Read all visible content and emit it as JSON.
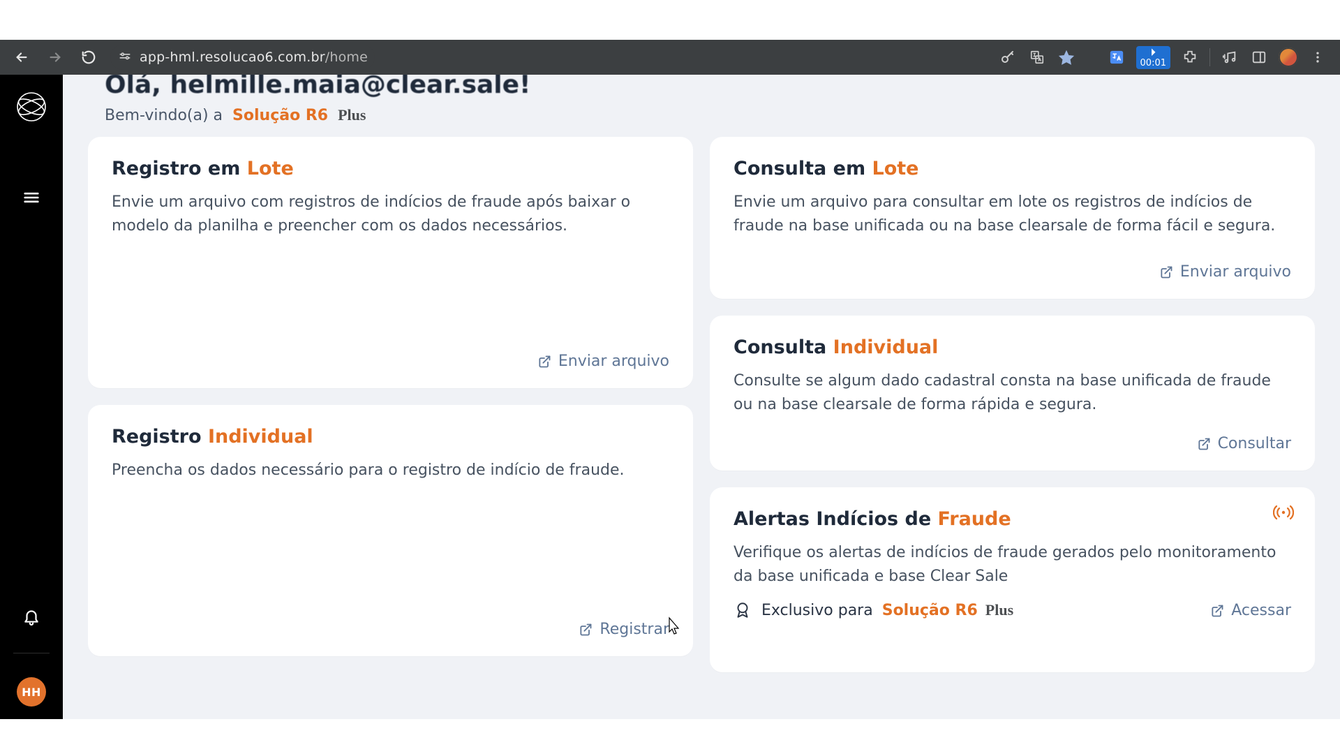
{
  "browser": {
    "url_host": "app-hml.resolucao6.com.br",
    "url_path": "/home",
    "timer": "00:01"
  },
  "sidebar": {
    "user_initials": "HH"
  },
  "header": {
    "greeting": "Olá, helmille.maia@clear.sale!",
    "welcome": "Bem-vindo(a) a",
    "brand": "Solução R6",
    "plus": "Plus"
  },
  "cards": {
    "registro_lote": {
      "title_a": "Registro em ",
      "title_b": "Lote",
      "body": "Envie um arquivo com registros de indícios de fraude após baixar o modelo da planilha e preencher com os dados necessários.",
      "action": "Enviar arquivo"
    },
    "registro_individual": {
      "title_a": "Registro ",
      "title_b": "Individual",
      "body": "Preencha os dados necessário para o registro de indício de fraude.",
      "action": "Registrar"
    },
    "consulta_lote": {
      "title_a": "Consulta em ",
      "title_b": "Lote",
      "body": "Envie um arquivo para consultar em lote os registros de indícios de fraude na base unificada ou na base clearsale de forma fácil e segura.",
      "action": "Enviar arquivo"
    },
    "consulta_individual": {
      "title_a": "Consulta ",
      "title_b": "Individual",
      "body": "Consulte se algum dado cadastral consta na base unificada de fraude ou na base clearsale de forma rápida e segura.",
      "action": "Consultar"
    },
    "alertas": {
      "title_a": "Alertas Indícios de ",
      "title_b": "Fraude",
      "body": "Verifique os alertas de indícios de fraude gerados pelo monitoramento da base unificada e base Clear Sale",
      "exclusive_pre": "Exclusivo para",
      "exclusive_brand": "Solução R6",
      "exclusive_plus": "Plus",
      "action": "Acessar"
    }
  }
}
